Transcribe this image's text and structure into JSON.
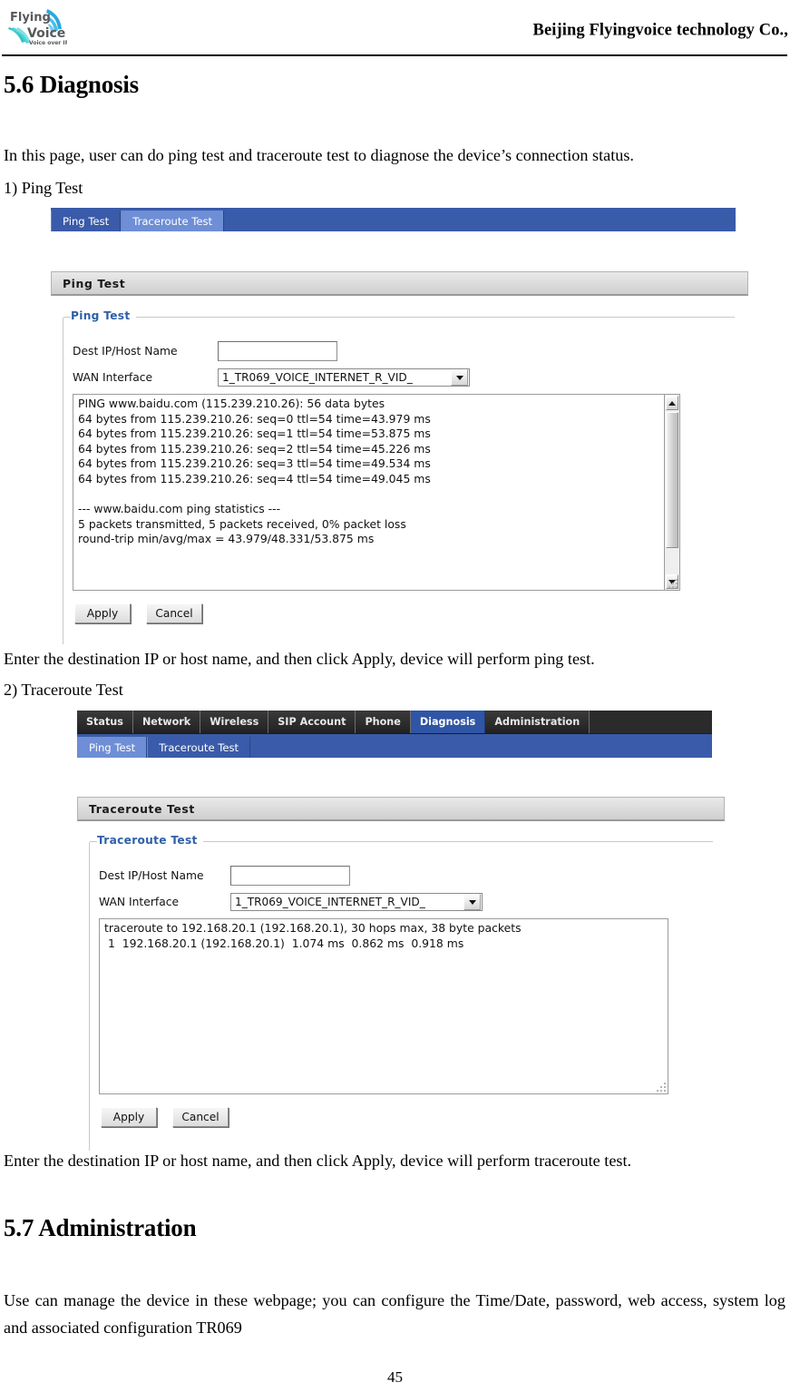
{
  "header": {
    "company": "Beijing Flyingvoice technology Co.,",
    "logo_top": "Flying",
    "logo_mid": "Voice",
    "logo_tagline": "Voice over IP"
  },
  "doc": {
    "section_56_heading": "5.6 Diagnosis",
    "intro": "In this page, user can do ping test and traceroute test to diagnose the device’s connection status.",
    "item1_label": "1) Ping Test",
    "caption1": "Enter the destination IP or host name, and then click Apply, device will perform ping test.",
    "item2_label": "2) Traceroute Test",
    "caption2": "Enter the destination IP or host name, and then click Apply, device will perform traceroute test.",
    "section_57_heading": "5.7 Administration",
    "admin_para": "Use can manage the device in these webpage; you can configure the Time/Date, password, web access, system log and associated configuration TR069",
    "page_number": "45"
  },
  "colors": {
    "subnav_bg": "#3a5ba9",
    "subnav_selected": "#6e8ed6",
    "topnav_bg": "#2b2b2b",
    "topnav_active": "#2f55a4",
    "legend_blue": "#2f5fa8",
    "panel_title_bg": "#d8d8d8"
  },
  "shot1": {
    "subnav": [
      {
        "label": "Ping Test",
        "selected": false
      },
      {
        "label": "Traceroute Test",
        "selected": true
      }
    ],
    "panel_title": "Ping Test",
    "fieldset_legend": "Ping Test",
    "fields": [
      {
        "label": "Dest IP/Host Name",
        "type": "text",
        "value": ""
      },
      {
        "label": "WAN Interface",
        "type": "select",
        "value": "1_TR069_VOICE_INTERNET_R_VID_"
      }
    ],
    "console_output": "PING www.baidu.com (115.239.210.26): 56 data bytes\n64 bytes from 115.239.210.26: seq=0 ttl=54 time=43.979 ms\n64 bytes from 115.239.210.26: seq=1 ttl=54 time=53.875 ms\n64 bytes from 115.239.210.26: seq=2 ttl=54 time=45.226 ms\n64 bytes from 115.239.210.26: seq=3 ttl=54 time=49.534 ms\n64 bytes from 115.239.210.26: seq=4 ttl=54 time=49.045 ms\n\n--- www.baidu.com ping statistics ---\n5 packets transmitted, 5 packets received, 0% packet loss\nround-trip min/avg/max = 43.979/48.331/53.875 ms",
    "apply_label": "Apply",
    "cancel_label": "Cancel"
  },
  "shot2": {
    "topnav": [
      {
        "label": "Status",
        "active": false
      },
      {
        "label": "Network",
        "active": false
      },
      {
        "label": "Wireless",
        "active": false
      },
      {
        "label": "SIP Account",
        "active": false
      },
      {
        "label": "Phone",
        "active": false
      },
      {
        "label": "Diagnosis",
        "active": true
      },
      {
        "label": "Administration",
        "active": false
      }
    ],
    "subnav": [
      {
        "label": "Ping Test",
        "selected": true
      },
      {
        "label": "Traceroute Test",
        "selected": false
      }
    ],
    "panel_title": "Traceroute Test",
    "fieldset_legend": "Traceroute Test",
    "fields": [
      {
        "label": "Dest IP/Host Name",
        "type": "text",
        "value": ""
      },
      {
        "label": "WAN Interface",
        "type": "select",
        "value": "1_TR069_VOICE_INTERNET_R_VID_"
      }
    ],
    "console_output": "traceroute to 192.168.20.1 (192.168.20.1), 30 hops max, 38 byte packets\n 1  192.168.20.1 (192.168.20.1)  1.074 ms  0.862 ms  0.918 ms",
    "apply_label": "Apply",
    "cancel_label": "Cancel"
  }
}
